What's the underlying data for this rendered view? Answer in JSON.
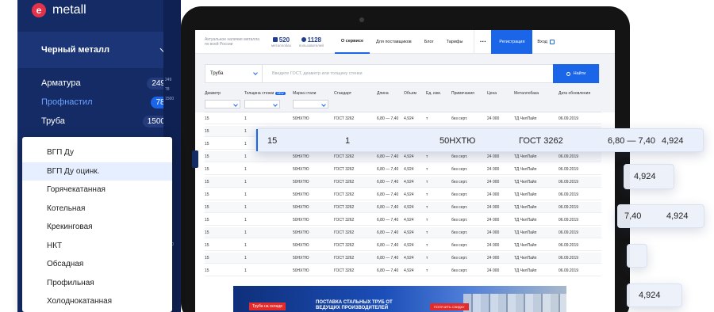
{
  "sidebar": {
    "logo_mark": "e",
    "logo_text": "metall",
    "category_title": "Черный металл",
    "items": [
      {
        "label": "Арматура",
        "count": "249"
      },
      {
        "label": "Профнастил",
        "count": "78"
      },
      {
        "label": "Труба",
        "count": "1500"
      }
    ],
    "strip_numbers": [
      "249",
      "78",
      "1500",
      "249",
      "78",
      "1500"
    ]
  },
  "dropdown": {
    "items": [
      "ВГП Ду",
      "ВГП Ду оцинк.",
      "Горячекатанная",
      "Котельная",
      "Крекинговая",
      "НКТ",
      "Обсадная",
      "Профильная",
      "Холоднокатанная"
    ]
  },
  "site": {
    "tagline": "Актуальное наличие металла по всей России",
    "stats": [
      {
        "value": "520",
        "label": "металлобаз"
      },
      {
        "value": "1128",
        "label": "пользователей"
      }
    ],
    "nav": [
      "О сервисе",
      "Для поставщиков",
      "Блог",
      "Тарифы"
    ],
    "more": "···",
    "register": "Регистрация",
    "login": "Вход"
  },
  "search": {
    "category": "Труба",
    "placeholder": "Введите ГОСТ, диаметр или толщину стенки",
    "button": "Найти"
  },
  "table": {
    "columns": [
      "Диаметр",
      "Толщина стенки",
      "Марка стали",
      "Стандарт",
      "Длина",
      "Объем",
      "Ед. изм.",
      "Примечания",
      "Цена",
      "Металлобаза",
      "Дата обновления"
    ],
    "new_badge": "NEW",
    "rows": [
      [
        "15",
        "1",
        "50НХТЮ",
        "ГОСТ 3262",
        "6,80 — 7,40",
        "4,924",
        "т",
        "без серт.",
        "24 000",
        "ТД ЧелПайп",
        "06.09.2019"
      ],
      [
        "15",
        "1",
        "",
        "",
        "",
        "",
        "",
        "",
        "",
        "",
        ""
      ],
      [
        "15",
        "1",
        "",
        "",
        "",
        "",
        "",
        "",
        "",
        "",
        ""
      ],
      [
        "15",
        "1",
        "50НХТЮ",
        "ГОСТ 3262",
        "6,80 — 7,40",
        "4,924",
        "т",
        "без серт.",
        "24 000",
        "ТД ЧелПайп",
        "06.09.2019"
      ],
      [
        "15",
        "1",
        "50НХТЮ",
        "ГОСТ 3262",
        "6,80 — 7,40",
        "4,924",
        "т",
        "без серт.",
        "24 000",
        "ТД ЧелПайп",
        "06.09.2019"
      ],
      [
        "15",
        "1",
        "50НХТЮ",
        "ГОСТ 3262",
        "6,80 — 7,40",
        "4,924",
        "т",
        "без серт.",
        "24 000",
        "ТД ЧелПайп",
        "06.09.2019"
      ],
      [
        "15",
        "1",
        "50НХТЮ",
        "ГОСТ 3262",
        "6,80 — 7,40",
        "4,924",
        "т",
        "без серт.",
        "24 000",
        "ТД ЧелПайп",
        "06.09.2019"
      ],
      [
        "15",
        "1",
        "50НХТЮ",
        "ГОСТ 3262",
        "6,80 — 7,40",
        "4,924",
        "т",
        "без серт.",
        "24 000",
        "ТД ЧелПайп",
        "06.09.2019"
      ],
      [
        "15",
        "1",
        "50НХТЮ",
        "ГОСТ 3262",
        "6,80 — 7,40",
        "4,924",
        "т",
        "без серт.",
        "24 000",
        "ТД ЧелПайп",
        "06.09.2019"
      ],
      [
        "15",
        "1",
        "50НХТЮ",
        "ГОСТ 3262",
        "6,80 — 7,40",
        "4,924",
        "т",
        "без серт.",
        "24 000",
        "ТД ЧелПайп",
        "06.09.2019"
      ],
      [
        "15",
        "1",
        "50НХТЮ",
        "ГОСТ 3262",
        "6,80 — 7,40",
        "4,924",
        "т",
        "без серт.",
        "24 000",
        "ТД ЧелПайп",
        "06.09.2019"
      ],
      [
        "15",
        "1",
        "50НХТЮ",
        "ГОСТ 3262",
        "6,80 — 7,40",
        "4,924",
        "т",
        "без серт.",
        "24 000",
        "ТД ЧелПайп",
        "06.09.2019"
      ],
      [
        "15",
        "1",
        "50НХТЮ",
        "ГОСТ 3262",
        "6,80 — 7,40",
        "4,924",
        "т",
        "без серт.",
        "24 000",
        "ТД ЧелПайп",
        "06.09.2019"
      ]
    ]
  },
  "highlight_row": [
    "15",
    "1",
    "50НХТЮ",
    "ГОСТ 3262",
    "6,80 — 7,40",
    "4,924"
  ],
  "floating_cards": [
    {
      "values": [
        "4,924"
      ]
    },
    {
      "values": [
        "7,40",
        "4,924"
      ]
    },
    {
      "values": [
        "4,924"
      ]
    }
  ],
  "banner": {
    "tag": "Труба на складе",
    "title": "ПОСТАВКА СТАЛЬНЫХ ТРУБ ОТ ВЕДУЩИХ ПРОИЗВОДИТЕЛЕЙ",
    "button": "ПОЛУЧИТЬ СКИДКУ"
  }
}
